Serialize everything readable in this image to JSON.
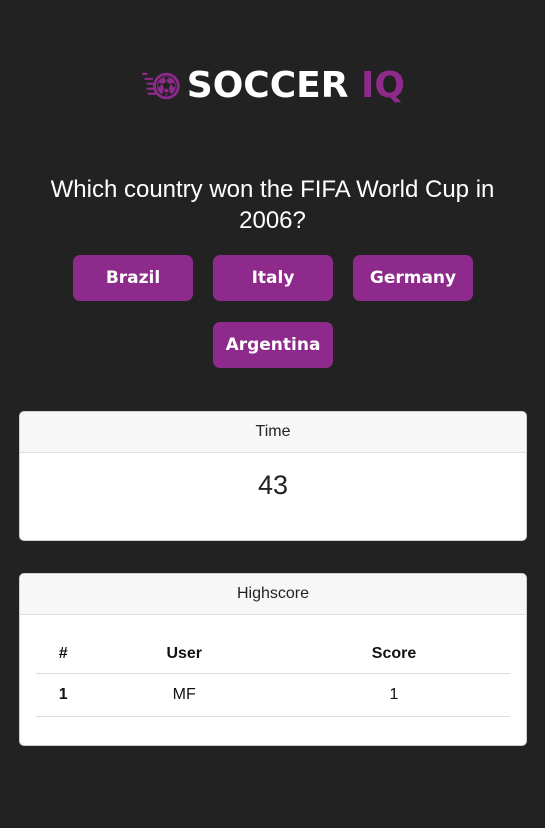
{
  "header": {
    "logo": {
      "word1": "SOCCER",
      "word2": "IQ",
      "icon": "soccer-ball-icon",
      "colors": {
        "primary": "#8e2a8b",
        "text": "#ffffff"
      }
    }
  },
  "quiz": {
    "question": "Which country won the FIFA World Cup in 2006?",
    "answers": [
      "Brazil",
      "Italy",
      "Germany",
      "Argentina"
    ]
  },
  "timer": {
    "title": "Time",
    "value": "43"
  },
  "highscore": {
    "title": "Highscore",
    "columns": [
      "#",
      "User",
      "Score"
    ],
    "rows": [
      {
        "rank": "1",
        "user": "MF",
        "score": "1"
      }
    ]
  },
  "theme": {
    "background": "#222222",
    "accent": "#8e2a8b"
  }
}
